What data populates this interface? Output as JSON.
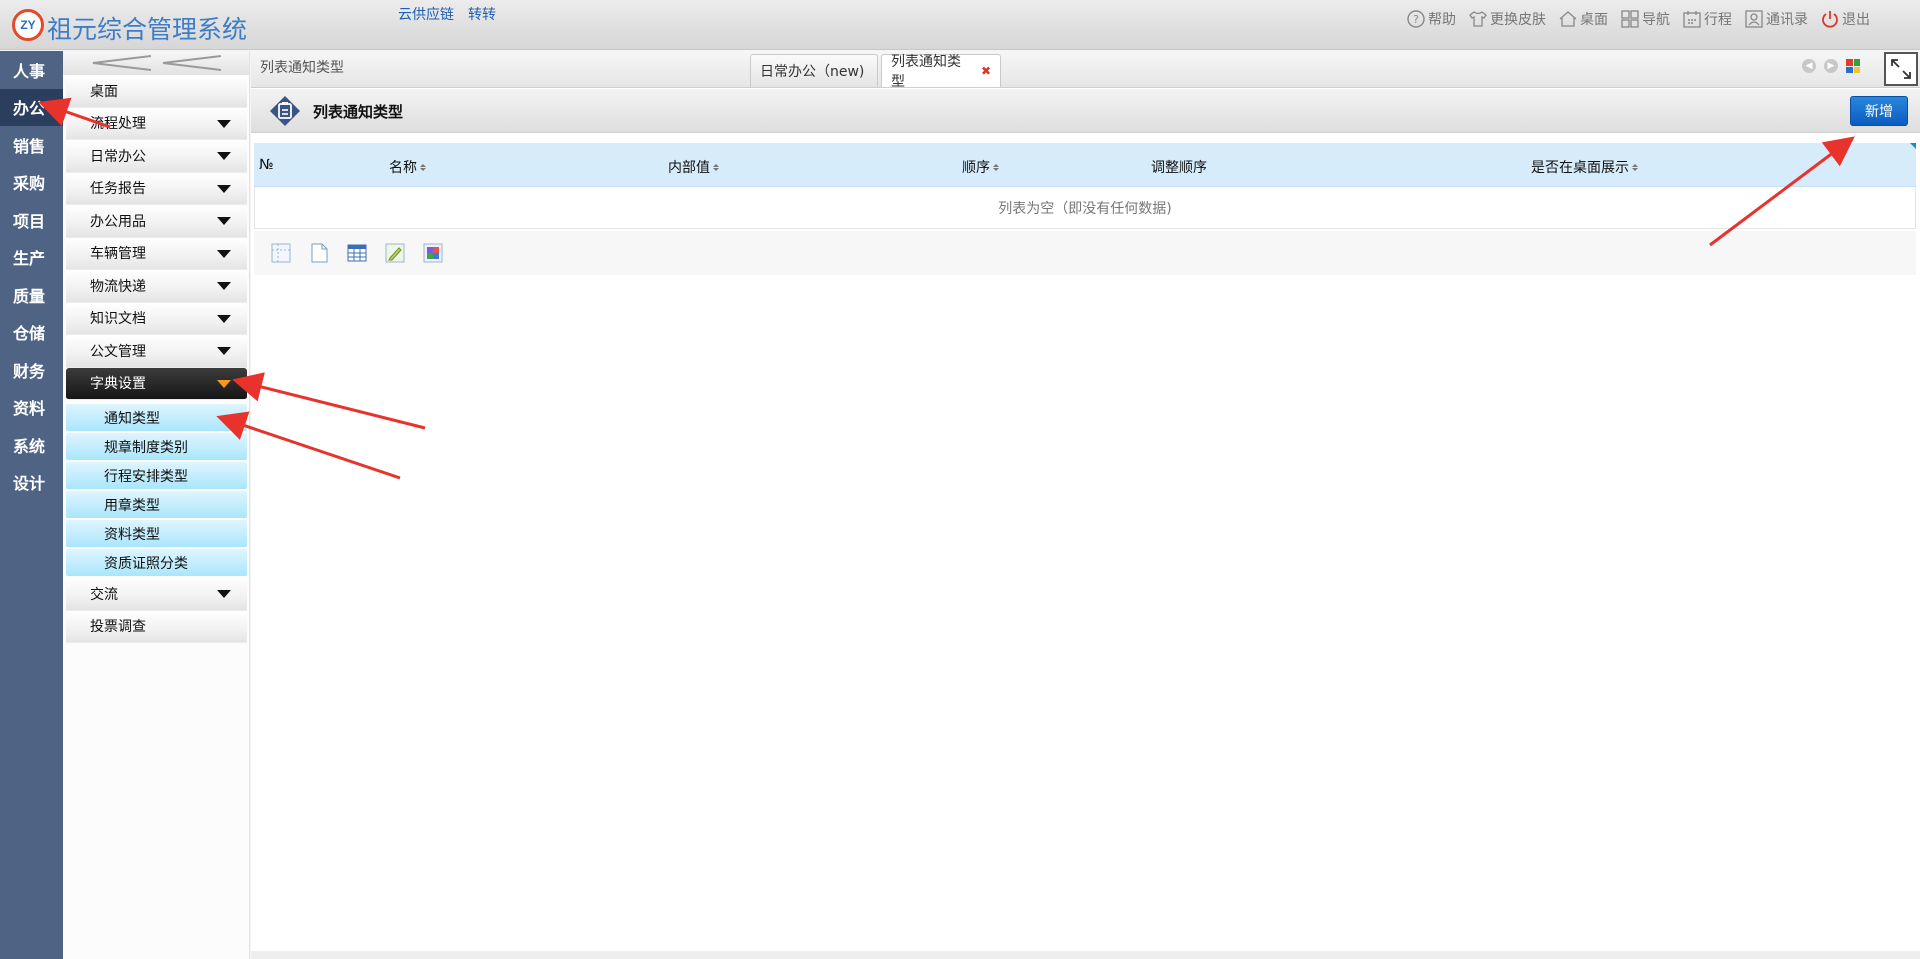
{
  "header": {
    "logo_text": "ZY",
    "app_title": "祖元综合管理系统",
    "top_links": [
      "云供应链",
      "转转"
    ],
    "menu": [
      {
        "label": "帮助",
        "icon": "help-icon"
      },
      {
        "label": "更换皮肤",
        "icon": "shirt-icon"
      },
      {
        "label": "桌面",
        "icon": "home-icon"
      },
      {
        "label": "导航",
        "icon": "grid-icon"
      },
      {
        "label": "行程",
        "icon": "calendar-icon"
      },
      {
        "label": "通讯录",
        "icon": "contact-icon"
      },
      {
        "label": "退出",
        "icon": "power-icon"
      }
    ]
  },
  "rail": {
    "items": [
      "人事",
      "办公",
      "销售",
      "采购",
      "项目",
      "生产",
      "质量",
      "仓储",
      "财务",
      "资料",
      "系统",
      "设计"
    ],
    "active_index": 1
  },
  "sidebar": {
    "collapse_icon": "double-chevron-left-icon",
    "items": [
      {
        "label": "桌面",
        "has_caret": false
      },
      {
        "label": "流程处理",
        "has_caret": true
      },
      {
        "label": "日常办公",
        "has_caret": true
      },
      {
        "label": "任务报告",
        "has_caret": true
      },
      {
        "label": "办公用品",
        "has_caret": true
      },
      {
        "label": "车辆管理",
        "has_caret": true
      },
      {
        "label": "物流快递",
        "has_caret": true
      },
      {
        "label": "知识文档",
        "has_caret": true
      },
      {
        "label": "公文管理",
        "has_caret": true
      },
      {
        "label": "字典设置",
        "has_caret": true,
        "active": true
      },
      {
        "label": "交流",
        "has_caret": true
      },
      {
        "label": "投票调查",
        "has_caret": false
      }
    ],
    "sub_items": [
      "通知类型",
      "规章制度类别",
      "行程安排类型",
      "用章类型",
      "资料类型",
      "资质证照分类"
    ]
  },
  "tabs": {
    "breadcrumb": "列表通知类型",
    "items": [
      {
        "label": "日常办公（new)"
      },
      {
        "label": "列表通知类型",
        "closable": true,
        "close_icon": "close-icon"
      }
    ]
  },
  "page": {
    "title": "列表通知类型",
    "title_icon": "clipboard-icon",
    "add_button": "新增"
  },
  "grid": {
    "columns": [
      {
        "label": "№",
        "sortable": false
      },
      {
        "label": "名称",
        "sortable": true
      },
      {
        "label": "内部值",
        "sortable": true
      },
      {
        "label": "顺序",
        "sortable": true
      },
      {
        "label": "调整顺序",
        "sortable": false
      },
      {
        "label": "是否在桌面展示",
        "sortable": true
      }
    ],
    "empty_text": "列表为空（即没有任何数据)"
  },
  "toolbar": {
    "icons": [
      "select-columns-icon",
      "blank-page-icon",
      "table-icon",
      "edit-pencil-icon",
      "puzzle-icon"
    ]
  },
  "colors": {
    "rail_bg": "#4f6485",
    "rail_active": "#2c3e5e",
    "accent_blue": "#0b5cbf",
    "grid_header": "#d7ecfb",
    "sub_item": "#a9e6fb",
    "annotation_red": "#e8322c"
  }
}
